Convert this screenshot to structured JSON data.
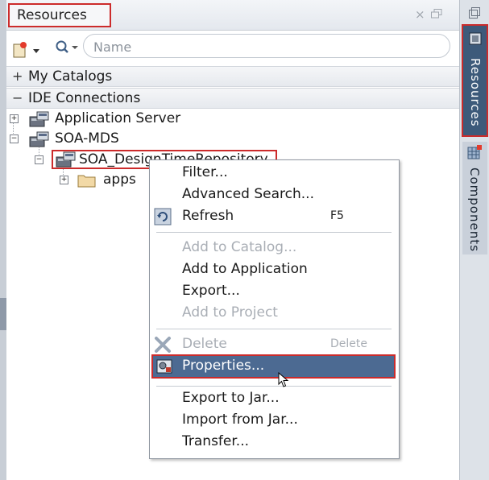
{
  "panel": {
    "title": "Resources",
    "close_glyph": "×"
  },
  "toolbar": {
    "new_icon": "new-document-icon",
    "search_icon": "search-icon",
    "search_placeholder": "Name"
  },
  "sections": {
    "my_catalogs": {
      "sign": "+",
      "label": "My Catalogs"
    },
    "ide_connections": {
      "sign": "−",
      "label": "IDE Connections"
    }
  },
  "tree": {
    "application_server": "Application Server",
    "soa_mds": "SOA-MDS",
    "soa_repo": "SOA_DesignTimeRepository",
    "apps": "apps",
    "expand_sign": "+",
    "collapse_sign": "−"
  },
  "sidebar": {
    "resources_label": "Resources",
    "components_label": "Components"
  },
  "context_menu": {
    "filter": "Filter...",
    "advanced_search": "Advanced Search...",
    "refresh": "Refresh",
    "refresh_shortcut": "F5",
    "add_to_catalog": "Add to Catalog...",
    "add_to_application": "Add to Application",
    "export": "Export...",
    "add_to_project": "Add to Project",
    "delete": "Delete",
    "delete_shortcut": "Delete",
    "properties": "Properties...",
    "export_to_jar": "Export to Jar...",
    "import_from_jar": "Import from Jar...",
    "transfer": "Transfer..."
  },
  "colors": {
    "highlight_border": "#cc2b2b",
    "selection": "#4c6a92",
    "active_tab": "#3d5a7a"
  }
}
